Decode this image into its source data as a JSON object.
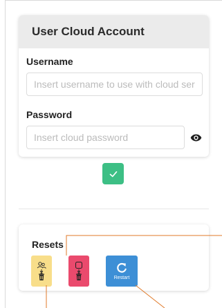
{
  "cloud_account": {
    "title": "User Cloud Account",
    "username_label": "Username",
    "username_placeholder": "Insert username to use with cloud ser",
    "password_label": "Password",
    "password_placeholder": "Insert cloud password"
  },
  "resets": {
    "title": "Resets",
    "restart_label": "Restart"
  },
  "colors": {
    "confirm": "#3dbf85",
    "reset_users": "#f8de8a",
    "reset_data": "#ea4a6d",
    "restart": "#3d8fd6",
    "annotation": "#e07a2a"
  },
  "icons": [
    "eye-icon",
    "check-icon",
    "users-trash-icon",
    "data-trash-icon",
    "restart-icon"
  ]
}
